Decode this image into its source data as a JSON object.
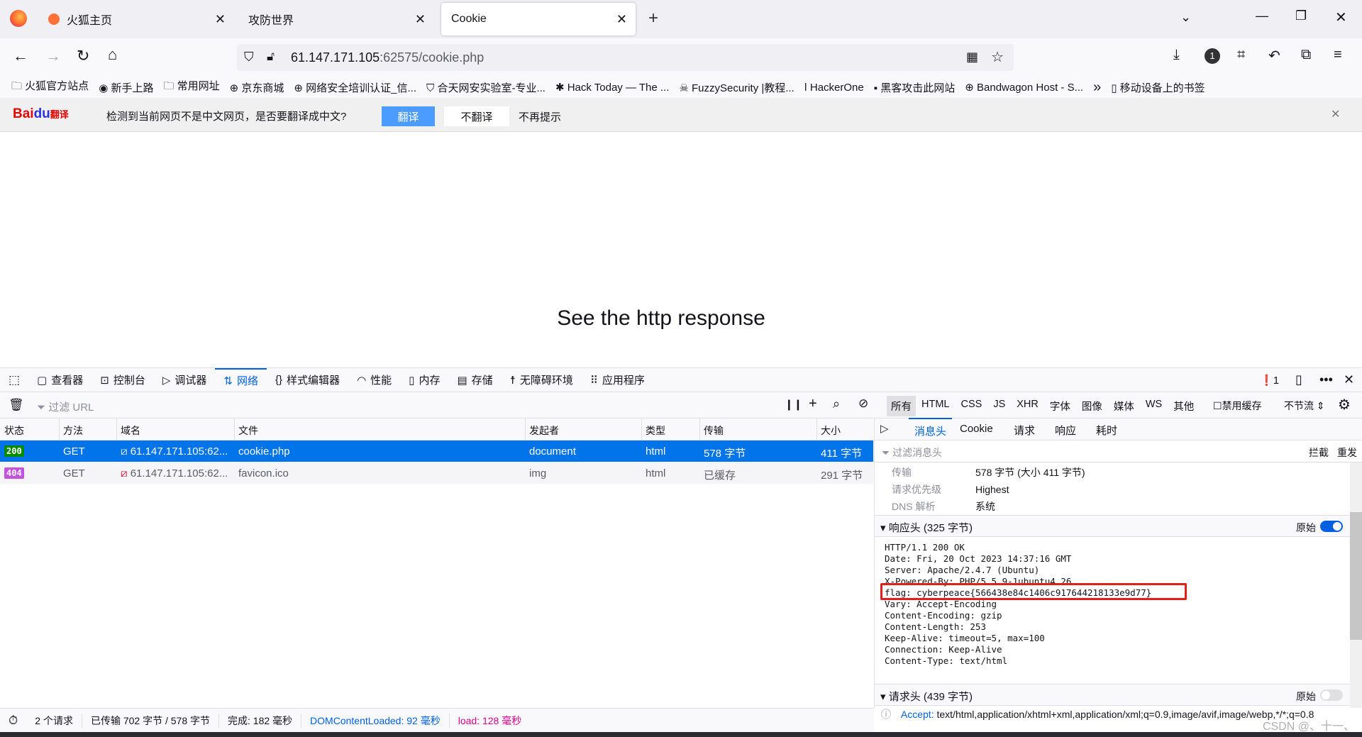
{
  "browser": {
    "tabs": [
      {
        "title": "火狐主页"
      },
      {
        "title": "攻防世界"
      },
      {
        "title": "Cookie"
      }
    ],
    "url_host": "61.147.171.105",
    "url_rest": ":62575/cookie.php",
    "bookmarks": [
      "火狐官方站点",
      "新手上路",
      "常用网址",
      "京东商城",
      "网络安全培训认证_信...",
      "合天网安实验室-专业...",
      "Hack Today — The ...",
      "FuzzySecurity |教程...",
      "HackerOne",
      "黑客攻击此网站",
      "Bandwagon Host - S..."
    ],
    "bookmarks_overflow": "»",
    "mobile_bookmarks": "移动设备上的书签"
  },
  "translate_bar": {
    "logo": "Bai du 翻译",
    "message": "检测到当前网页不是中文网页，是否要翻译成中文?",
    "translate": "翻译",
    "no_translate": "不翻译",
    "never": "不再提示"
  },
  "page": {
    "text": "See the http response"
  },
  "devtools": {
    "tools": [
      "查看器",
      "控制台",
      "调试器",
      "网络",
      "样式编辑器",
      "性能",
      "内存",
      "存储",
      "无障碍环境",
      "应用程序"
    ],
    "selected_tool": "网络",
    "error_count": "1",
    "filter_placeholder": "过滤 URL",
    "type_filters": [
      "所有",
      "HTML",
      "CSS",
      "JS",
      "XHR",
      "字体",
      "图像",
      "媒体",
      "WS",
      "其他"
    ],
    "disable_cache": "禁用缓存",
    "throttle": "不节流 ⇕",
    "columns": [
      "状态",
      "方法",
      "域名",
      "文件",
      "发起者",
      "类型",
      "传输",
      "大小"
    ],
    "rows": [
      {
        "status": "200",
        "method": "GET",
        "domain": "61.147.171.105:62...",
        "file": "cookie.php",
        "initiator": "document",
        "type": "html",
        "transfer": "578 字节",
        "size": "411 字节"
      },
      {
        "status": "404",
        "method": "GET",
        "domain": "61.147.171.105:62...",
        "file": "favicon.ico",
        "initiator": "img",
        "type": "html",
        "transfer": "已缓存",
        "size": "291 字节"
      }
    ],
    "detail_tabs": [
      "消息头",
      "Cookie",
      "请求",
      "响应",
      "耗时"
    ],
    "detail_filter_placeholder": "过滤消息头",
    "block": "拦截",
    "resend": "重发",
    "info": [
      {
        "k": "传输",
        "v": "578 字节 (大小 411 字节)"
      },
      {
        "k": "请求优先级",
        "v": "Highest"
      },
      {
        "k": "DNS 解析",
        "v": "系统"
      }
    ],
    "response_headers_title": "响应头 (325 字节)",
    "raw_label": "原始",
    "response_lines": [
      "HTTP/1.1 200 OK",
      "Date: Fri, 20 Oct 2023 14:37:16 GMT",
      "Server: Apache/2.4.7 (Ubuntu)",
      "X-Powered-By: PHP/5.5.9-1ubuntu4.26",
      "flag: cyberpeace{566438e84c1406c917644218133e9d77}",
      "Vary: Accept-Encoding",
      "Content-Encoding: gzip",
      "Content-Length: 253",
      "Keep-Alive: timeout=5, max=100",
      "Connection: Keep-Alive",
      "Content-Type: text/html"
    ],
    "request_headers_title": "请求头 (439 字节)",
    "accept_key": "Accept:",
    "accept_value": "text/html,application/xhtml+xml,application/xml;q=0.9,image/avif,image/webp,*/*;q=0.8",
    "status_bar": {
      "requests": "2 个请求",
      "transferred": "已传输 702 字节 / 578 字节",
      "finish": "完成: 182 毫秒",
      "dcl": "DOMContentLoaded: 92 毫秒",
      "load": "load: 128 毫秒"
    }
  },
  "watermark": "CSDN @、十一、",
  "colors": {
    "accent": "#0061e0",
    "selected_row": "#0074e8",
    "status_200": "#058b00",
    "status_404": "#c451e0",
    "highlight_box": "#e0201a",
    "load": "#d7008f"
  }
}
